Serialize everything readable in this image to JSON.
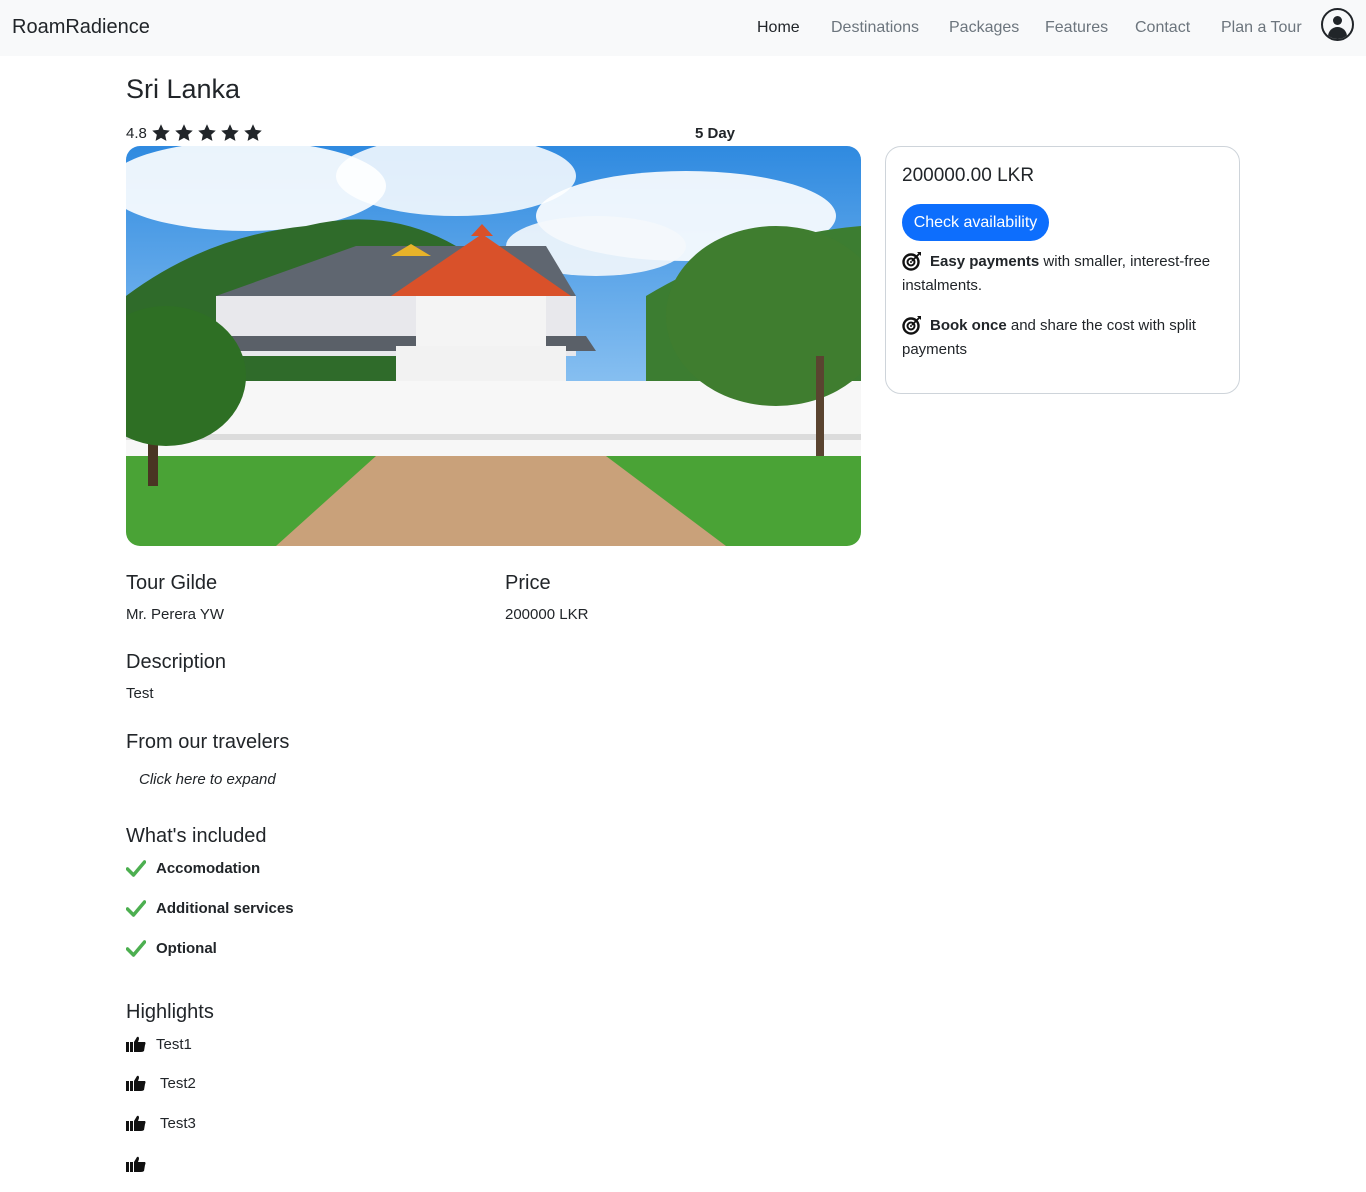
{
  "nav": {
    "brand": "RoamRadience",
    "links": [
      {
        "label": "Home"
      },
      {
        "label": "Destinations"
      },
      {
        "label": "Packages"
      },
      {
        "label": "Features"
      },
      {
        "label": "Contact"
      },
      {
        "label": "Plan a Tour"
      }
    ],
    "active": "Home",
    "profile_icon": "user-circle-icon"
  },
  "tour": {
    "title": "Sri Lanka",
    "rating": "4.8",
    "stars": 5,
    "duration": "5 Day",
    "image": "temple-photo"
  },
  "booking": {
    "price": "200000.00 LKR",
    "button": "Check availability",
    "perks": [
      {
        "bold": "Easy payments",
        "rest": " with smaller, interest-free instalments.",
        "icon": "target-icon"
      },
      {
        "bold": "Book once",
        "rest": " and share the cost with split payments",
        "icon": "target-icon"
      }
    ]
  },
  "details": {
    "guide_heading": "Tour Gilde",
    "guide_value": "Mr. Perera YW",
    "price_heading": "Price",
    "price_value": "200000 LKR",
    "description_heading": "Description",
    "description_value": "Test",
    "travelers_heading": "From our travelers",
    "travelers_expand": "Click here to expand"
  },
  "included": {
    "heading": "What's included",
    "items": [
      "Accomodation",
      "Additional services",
      "Optional"
    ],
    "check_color": "#4caf50"
  },
  "highlights": {
    "heading": "Highlights",
    "items": [
      "Test1",
      "Test2",
      "Test3",
      ""
    ]
  },
  "colors": {
    "primary": "#0d6efd",
    "navbar_bg": "#f8f9fa",
    "text": "#212529",
    "muted": "#6c757d"
  }
}
